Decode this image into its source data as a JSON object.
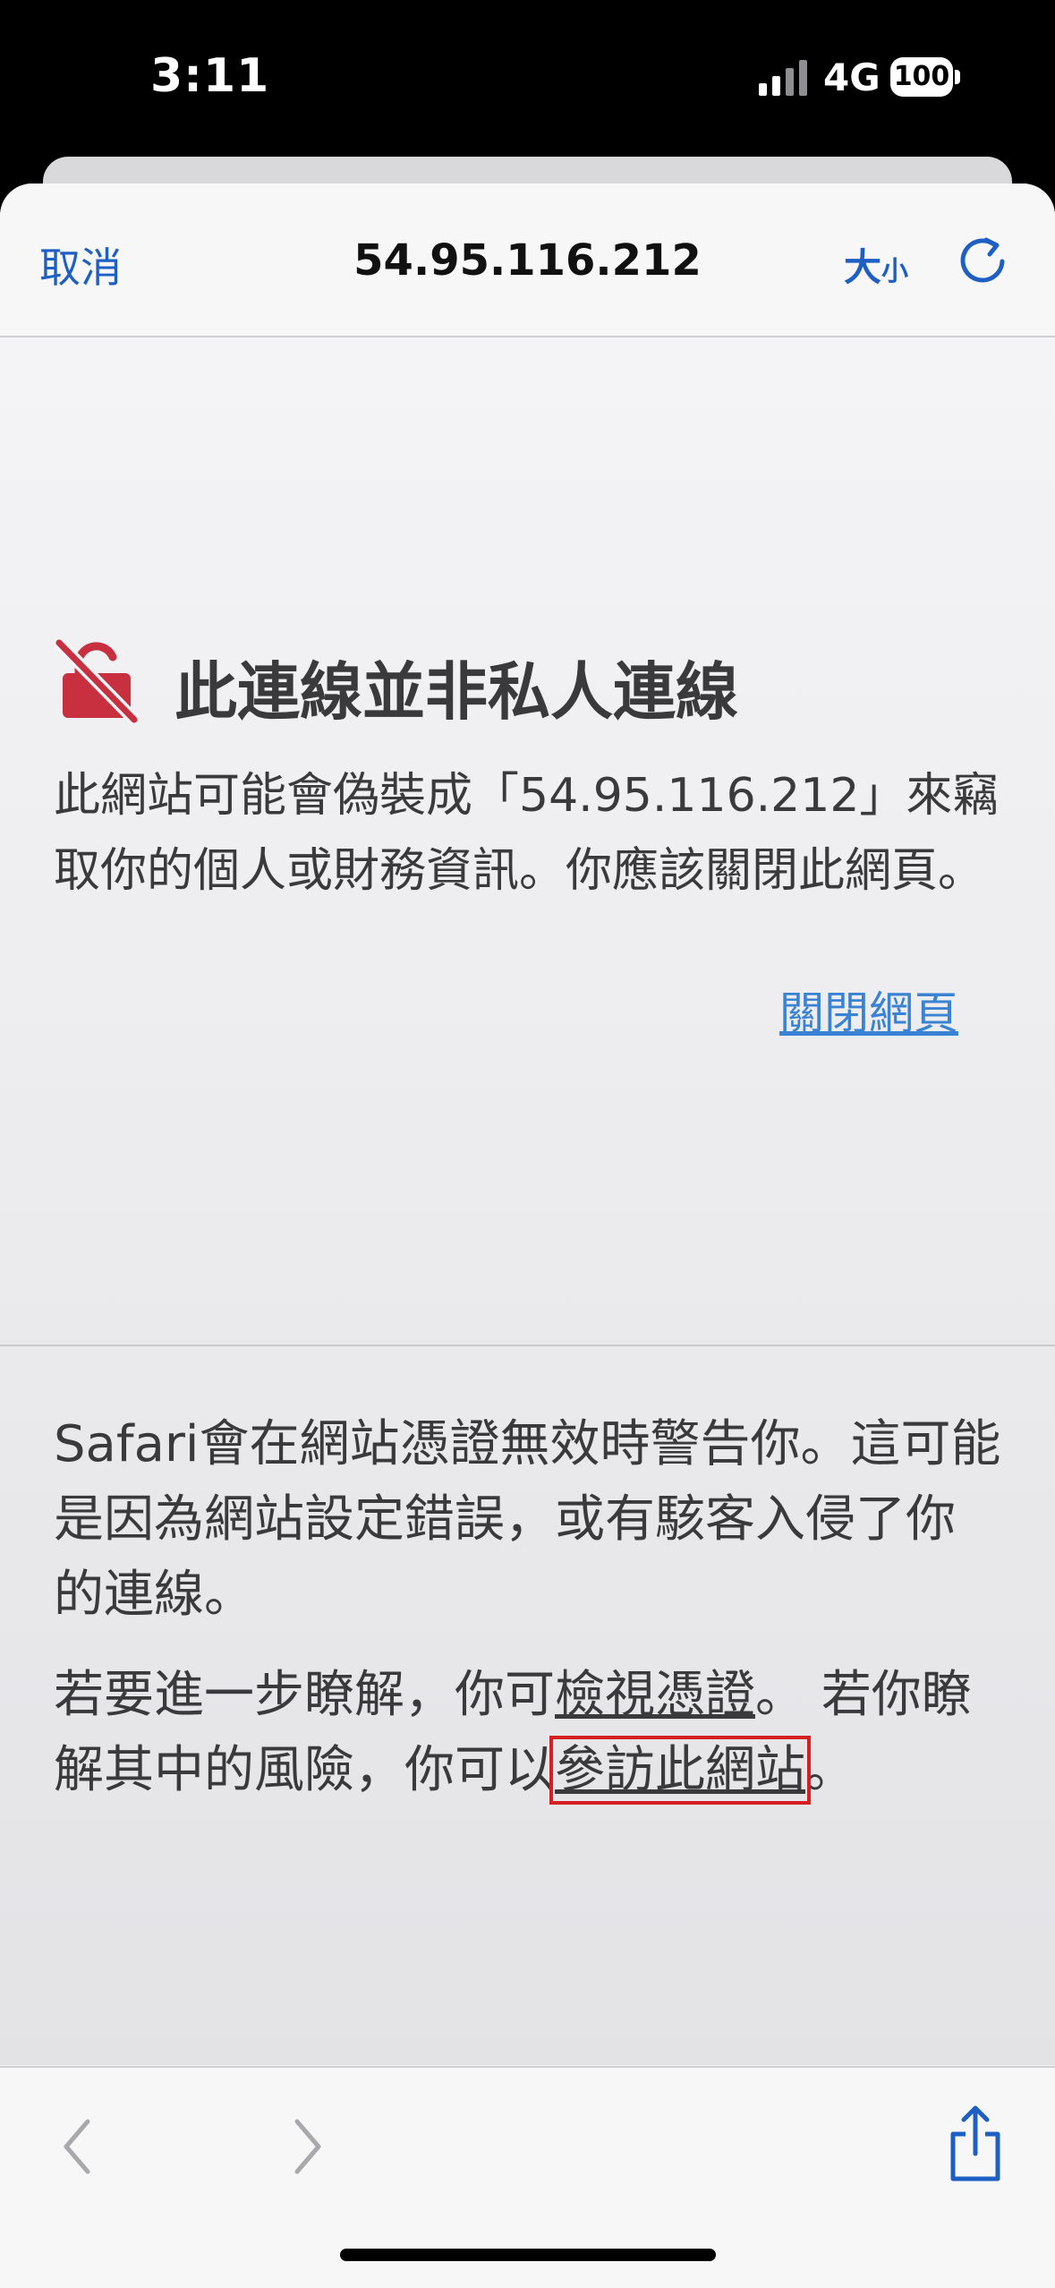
{
  "status_bar": {
    "time": "3:11",
    "network": "4G",
    "battery": "100"
  },
  "nav": {
    "cancel_label": "取消",
    "title": "54.95.116.212",
    "size_label_big": "大",
    "size_label_small": "小"
  },
  "warning": {
    "title": "此連線並非私人連線",
    "body": "此網站可能會偽裝成「54.95.116.212」來竊取你的個人或財務資訊。你應該關閉此網頁。",
    "close_link": "關閉網頁"
  },
  "details": {
    "info": "Safari會在網站憑證無效時警告你。這可能是因為網站設定錯誤，或有駭客入侵了你的連線。",
    "more_prefix": "若要進一步瞭解，你可",
    "view_cert_link": "檢視憑證",
    "more_middle": "。 若你瞭解其中的風險，你可以",
    "visit_link": "參訪此網站",
    "more_suffix": "。"
  },
  "colors": {
    "accent": "#1f5fc4",
    "warning_icon": "#c8303f",
    "highlight_box": "#d42020"
  },
  "icons": {
    "warning": "broken-lock-icon",
    "reload": "reload-icon",
    "back": "chevron-left-icon",
    "forward": "chevron-right-icon",
    "share": "share-icon"
  }
}
